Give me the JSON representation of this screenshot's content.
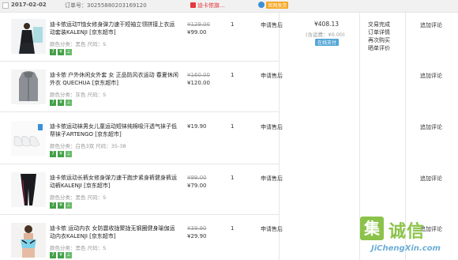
{
  "header": {
    "date": "2017-02-02",
    "order_label": "订单号：",
    "order_number": "30255880203169120",
    "shop": "迪卡侬旗…",
    "badge": "官网发货"
  },
  "products": [
    {
      "title": "迪卡侬运动T恤女修身弹力速干短袖立领拼接上衣运动套装KALENJI [京东超市]",
      "attrs": "颜色分类：黑色  尺码：S",
      "original_price": "¥129.00",
      "price": "¥99.00",
      "qty": "1",
      "service": "申请售后",
      "review": "追加评论"
    },
    {
      "title": "迪卡侬 户外休闲女外套 女 正品防风衣运动 春夏休闲外衣 QUECHUA [京东超市]",
      "attrs": "颜色分类：灰色  尺码：S",
      "original_price": "¥160.00",
      "price": "¥120.00",
      "qty": "1",
      "service": "申请售后",
      "review": "追加评论"
    },
    {
      "title": "迪卡侬运动袜男女儿童运动短袜纯棉吸汗透气袜子低帮袜子ARTENGO [京东超市]",
      "attrs": "颜色分类：白色3双  尺码：35-38",
      "original_price": "",
      "price": "¥19.90",
      "qty": "1",
      "service": "申请售后",
      "review": "追加评论"
    },
    {
      "title": "迪卡侬运动长裤女修身弹力速干跑步紧身裤健身裤运动裤KALENJI [京东超市]",
      "attrs": "颜色分类：黑色  尺码：S",
      "original_price": "¥99.00",
      "price": "¥79.00",
      "qty": "1",
      "service": "申请售后",
      "review": "追加评论"
    },
    {
      "title": "迪卡侬 运动内衣 女防震收拢聚拢无钢圈健身瑜伽运动内衣KALENJI [京东超市]",
      "attrs": "颜色分类：黑色  尺码：S",
      "original_price": "¥39.90",
      "price": "¥29.90",
      "qty": "1",
      "service": "申请售后",
      "review": "追加评论"
    }
  ],
  "order": {
    "total": "¥408.13",
    "shipping": "(含运费：¥0.00)",
    "pay_method": "在线支付",
    "status": "交易完成",
    "detail": "订单详情",
    "reorder": "再次购买",
    "extra": "晒单评价"
  },
  "watermark": {
    "icon": "集",
    "name": "诚信",
    "url": "JiChengXin.com"
  }
}
